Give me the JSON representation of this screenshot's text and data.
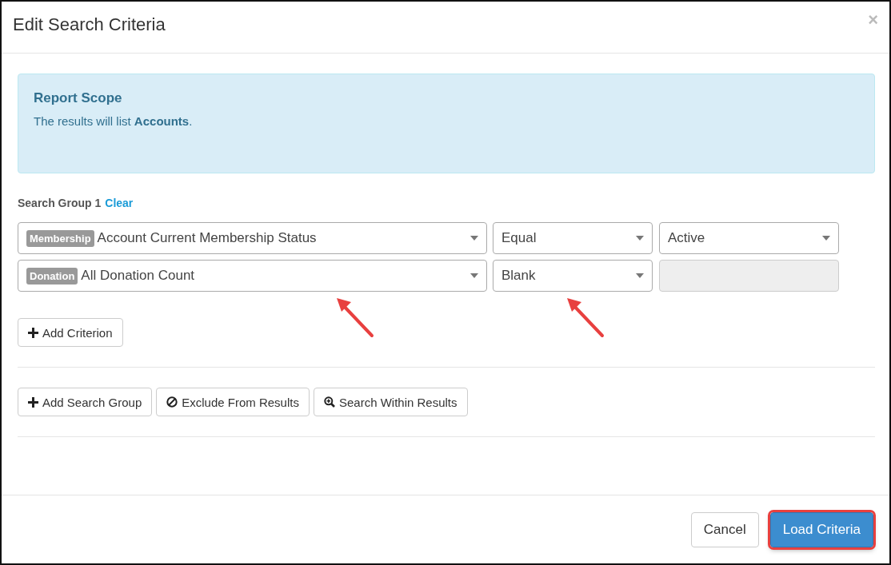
{
  "dialog": {
    "title": "Edit Search Criteria",
    "close": "×"
  },
  "scope": {
    "heading": "Report Scope",
    "text": "The results will list **Accounts**."
  },
  "group": {
    "label": "Search Group 1",
    "clear": "Clear"
  },
  "criteria": [
    {
      "category": "Membership",
      "field": "Account Current Membership Status",
      "operator": "Equal",
      "value": {
        "text": "Active",
        "disabled": false
      }
    },
    {
      "category": "Donation",
      "field": "All Donation Count",
      "operator": "Blank",
      "value": {
        "disabled": true
      }
    }
  ],
  "add_criterion": {
    "label": "Add Criterion",
    "kind": "add"
  },
  "group_actions": [
    {
      "label": "Add Search Group",
      "kind": "add"
    },
    {
      "label": "Exclude From Results",
      "kind": "exclude"
    },
    {
      "label": "Search Within Results",
      "kind": "within"
    }
  ],
  "footer": [
    {
      "label": "Cancel",
      "kind": "default",
      "highlighted": false
    },
    {
      "label": "Load Criteria",
      "kind": "primary",
      "highlighted": true
    }
  ]
}
